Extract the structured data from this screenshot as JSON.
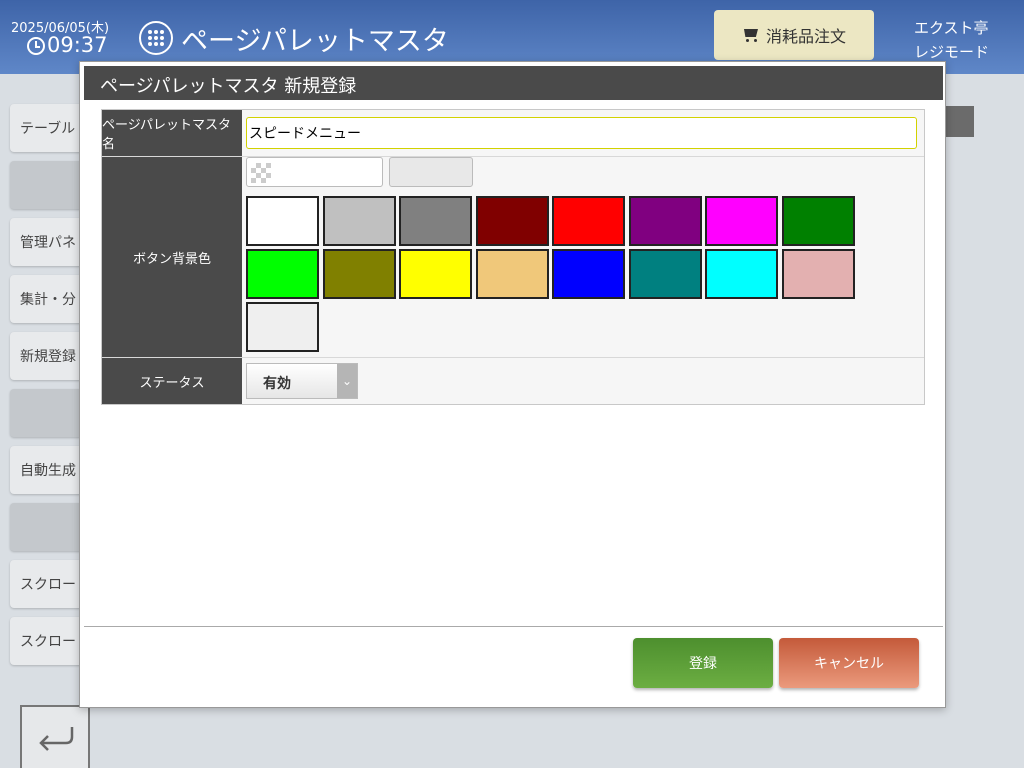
{
  "header": {
    "date": "2025/06/05(木)",
    "time": "09:37",
    "app_title": "ページパレットマスタ",
    "order_button": "消耗品注文",
    "shop_name": "エクスト亭",
    "mode": "レジモード"
  },
  "side_menu": [
    {
      "label": "テーブル",
      "style": "normal"
    },
    {
      "label": "",
      "style": "dark"
    },
    {
      "label": "管理パネ",
      "style": "normal"
    },
    {
      "label": "集計・分",
      "style": "normal"
    },
    {
      "label": "新規登録",
      "style": "normal"
    },
    {
      "label": "",
      "style": "dark"
    },
    {
      "label": "自動生成",
      "style": "normal"
    },
    {
      "label": "",
      "style": "dark"
    },
    {
      "label": "スクロー",
      "style": "normal"
    },
    {
      "label": "スクロー",
      "style": "normal"
    }
  ],
  "modal": {
    "title": "ページパレットマスタ 新規登録",
    "fields": {
      "name_label": "ページパレットマスタ名",
      "name_value": "スピードメニュー",
      "color_label": "ボタン背景色",
      "status_label": "ステータス",
      "status_value": "有効"
    },
    "swatch_colors": [
      "#ffffff",
      "#c0c0c0",
      "#808080",
      "#800000",
      "#ff0000",
      "#800080",
      "#ff00ff",
      "#008000",
      "#00ff00",
      "#808000",
      "#ffff00",
      "#f0c87a",
      "#0000ff",
      "#008080",
      "#00ffff",
      "#e3b0b0",
      "#efefef"
    ],
    "buttons": {
      "register": "登録",
      "cancel": "キャンセル"
    }
  }
}
